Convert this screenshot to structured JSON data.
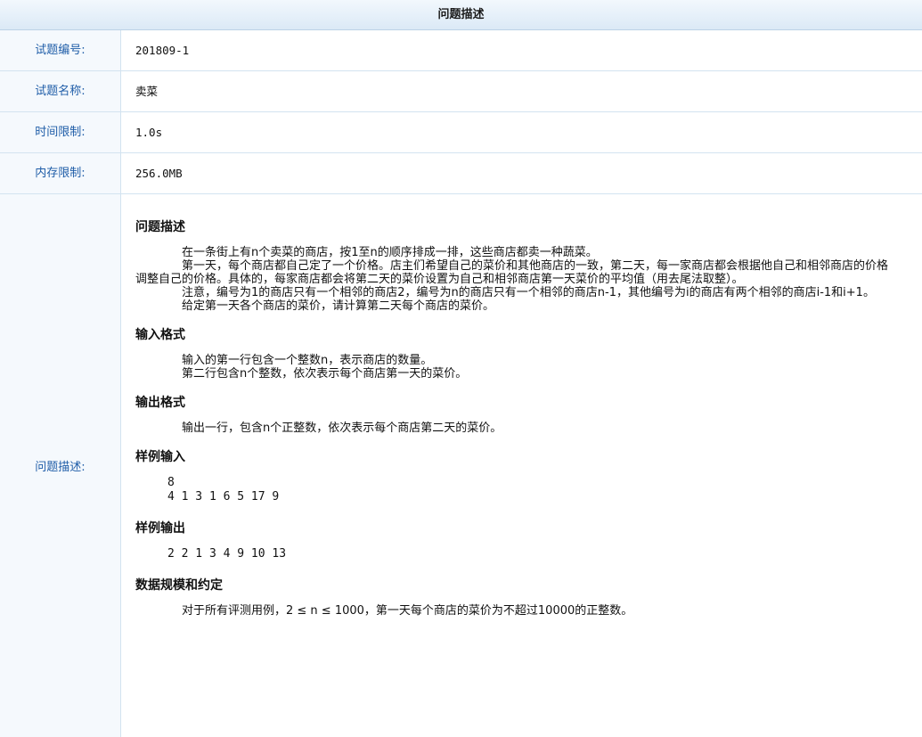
{
  "header": {
    "title": "问题描述"
  },
  "fields": [
    {
      "label": "试题编号:",
      "value": "201809-1"
    },
    {
      "label": "试题名称:",
      "value": "卖菜"
    },
    {
      "label": "时间限制:",
      "value": "1.0s"
    },
    {
      "label": "内存限制:",
      "value": "256.0MB"
    }
  ],
  "description": {
    "label": "问题描述:",
    "sections": {
      "problem_title": "问题描述",
      "problem_paragraphs": [
        "在一条街上有n个卖菜的商店，按1至n的顺序排成一排，这些商店都卖一种蔬菜。",
        "第一天，每个商店都自己定了一个价格。店主们希望自己的菜价和其他商店的一致，第二天，每一家商店都会根据他自己和相邻商店的价格调整自己的价格。具体的，每家商店都会将第二天的菜价设置为自己和相邻商店第一天菜价的平均值（用去尾法取整）。",
        "注意，编号为1的商店只有一个相邻的商店2，编号为n的商店只有一个相邻的商店n-1，其他编号为i的商店有两个相邻的商店i-1和i+1。",
        "给定第一天各个商店的菜价，请计算第二天每个商店的菜价。"
      ],
      "input_title": "输入格式",
      "input_paragraphs": [
        "输入的第一行包含一个整数n，表示商店的数量。",
        "第二行包含n个整数，依次表示每个商店第一天的菜价。"
      ],
      "output_title": "输出格式",
      "output_paragraphs": [
        "输出一行，包含n个正整数，依次表示每个商店第二天的菜价。"
      ],
      "sample_input_title": "样例输入",
      "sample_input_lines": [
        "8",
        "4 1 3 1 6 5 17 9"
      ],
      "sample_output_title": "样例输出",
      "sample_output_lines": [
        "2 2 1 3 4 9 10 13"
      ],
      "limits_title": "数据规模和约定",
      "limits_paragraphs": [
        "对于所有评测用例，2 ≤ n ≤ 1000，第一天每个商店的菜价为不超过10000的正整数。"
      ]
    }
  }
}
